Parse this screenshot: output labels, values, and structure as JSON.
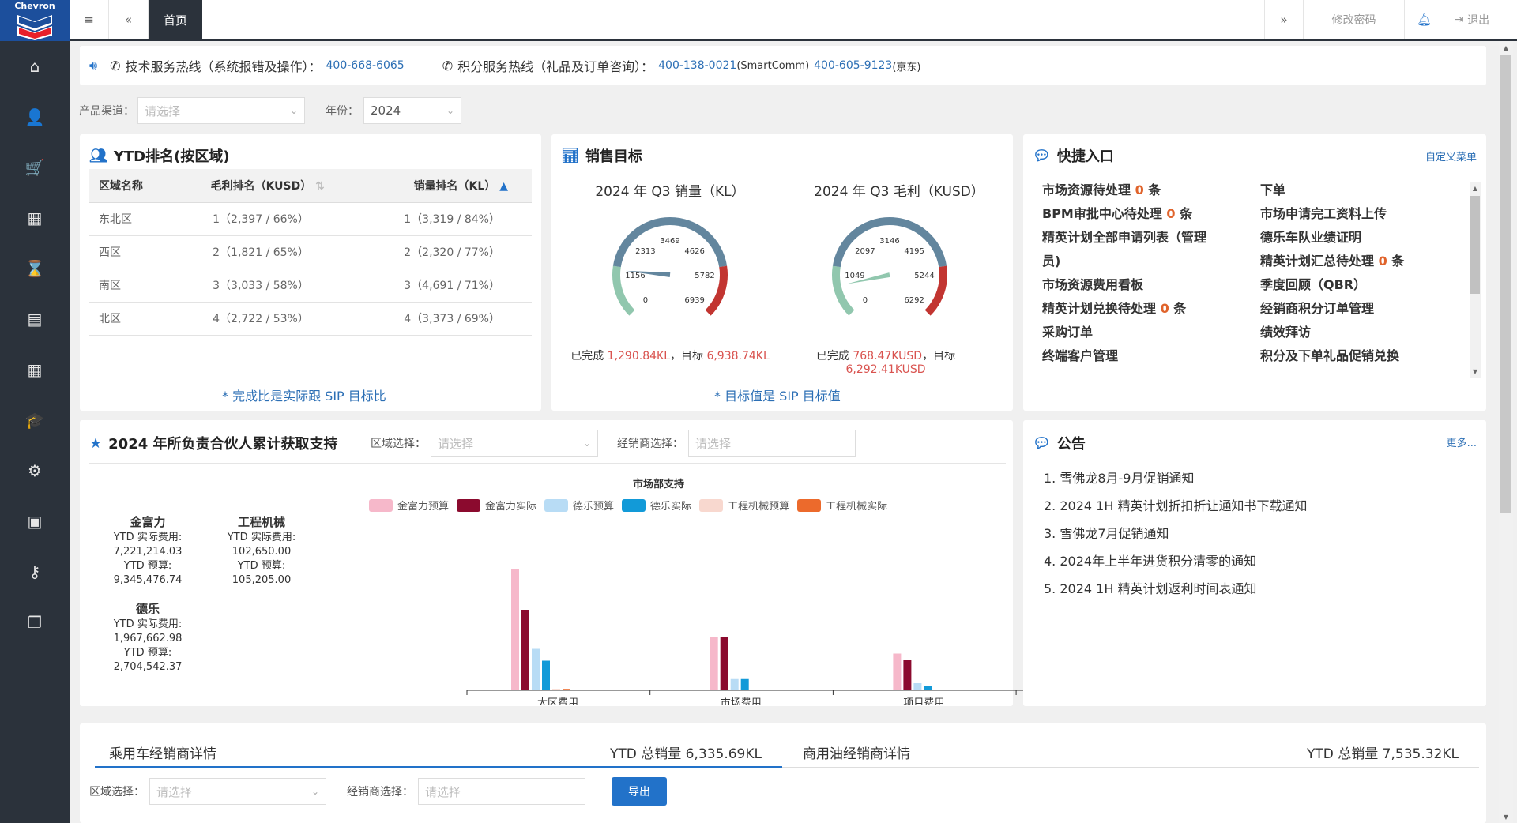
{
  "logo": {
    "text": "Chevron"
  },
  "topbar": {
    "home_tab": "首页",
    "change_password": "修改密码",
    "logout": "退出"
  },
  "hotline": {
    "tech_label": "技术服务热线（系统报错及操作）：",
    "tech_number": "400-668-6065",
    "points_label": "积分服务热线（礼品及订单咨询）：",
    "points_number1": "400-138-0021",
    "points_note1": "(SmartComm)",
    "points_number2": "400-605-9123",
    "points_note2": "(京东)"
  },
  "filters": {
    "channel_label": "产品渠道：",
    "channel_placeholder": "请选择",
    "year_label": "年份：",
    "year_value": "2024"
  },
  "ytd_rank": {
    "title": "YTD排名(按区域)",
    "headers": [
      "区域名称",
      "毛利排名（KUSD）",
      "销量排名（KL）"
    ],
    "rows": [
      [
        "东北区",
        "1（2,397 / 66%）",
        "1（3,319 / 84%）"
      ],
      [
        "西区",
        "2（1,821 / 65%）",
        "2（2,320 / 77%）"
      ],
      [
        "南区",
        "3（3,033 / 58%）",
        "3（4,691 / 71%）"
      ],
      [
        "北区",
        "4（2,722 / 53%）",
        "4（3,373 / 69%）"
      ]
    ],
    "note": "* 完成比是实际跟 SIP 目标比"
  },
  "sales_target": {
    "title": "销售目标",
    "g1_title": "2024 年 Q3 销量（KL）",
    "g1_done_prefix": "已完成 ",
    "g1_done": "1,290.84KL",
    "g1_mid": "，目标 ",
    "g1_target": "6,938.74KL",
    "g2_title": "2024 年 Q3 毛利（KUSD）",
    "g2_done_prefix": "已完成 ",
    "g2_done": "768.47KUSD",
    "g2_mid": "，目标",
    "g2_target": "6,292.41KUSD",
    "note": "* 目标值是 SIP 目标值"
  },
  "gauge1": {
    "value": 1290.84,
    "max": 6938.74,
    "ticks": [
      "0",
      "1156",
      "2313",
      "3469",
      "4626",
      "5782",
      "6939"
    ]
  },
  "gauge2": {
    "value": 768.47,
    "max": 6292.41,
    "ticks": [
      "0",
      "1049",
      "2097",
      "3146",
      "4195",
      "5244",
      "6292"
    ]
  },
  "quick": {
    "title": "快捷入口",
    "custom": "自定义菜单",
    "left": [
      {
        "t": "市场资源待处理 ",
        "n": "0",
        "s": " 条"
      },
      {
        "t": "BPM审批中心待处理 ",
        "n": "0",
        "s": " 条"
      },
      {
        "t": "精英计划全部申请列表（管理",
        "n": "",
        "s": ""
      },
      {
        "t": "员)",
        "n": "",
        "s": ""
      },
      {
        "t": "市场资源费用看板",
        "n": "",
        "s": ""
      },
      {
        "t": "精英计划兑换待处理 ",
        "n": "0",
        "s": " 条"
      },
      {
        "t": "采购订单",
        "n": "",
        "s": ""
      },
      {
        "t": "终端客户管理",
        "n": "",
        "s": ""
      }
    ],
    "right": [
      {
        "t": "下单",
        "n": "",
        "s": ""
      },
      {
        "t": "市场申请完工资料上传",
        "n": "",
        "s": ""
      },
      {
        "t": "德乐车队业绩证明",
        "n": "",
        "s": ""
      },
      {
        "t": "精英计划汇总待处理 ",
        "n": "0",
        "s": " 条"
      },
      {
        "t": "季度回顾（QBR）",
        "n": "",
        "s": ""
      },
      {
        "t": "经销商积分订单管理",
        "n": "",
        "s": ""
      },
      {
        "t": "绩效拜访",
        "n": "",
        "s": ""
      },
      {
        "t": "积分及下单礼品促销兑换",
        "n": "",
        "s": ""
      }
    ]
  },
  "support": {
    "title": "2024 年所负责合伙人累计获取支持",
    "region_label": "区域选择：",
    "region_placeholder": "请选择",
    "dealer_label": "经销商选择：",
    "dealer_placeholder": "请选择",
    "stats": [
      {
        "name": "金富力",
        "l1": "YTD 实际费用:",
        "v1": "7,221,214.03",
        "l2": "YTD 预算:",
        "v2": "9,345,476.74"
      },
      {
        "name": "工程机械",
        "l1": "YTD 实际费用:",
        "v1": "102,650.00",
        "l2": "YTD 预算:",
        "v2": "105,205.00"
      },
      {
        "name": "德乐",
        "l1": "YTD 实际费用:",
        "v1": "1,967,662.98",
        "l2": "YTD 预算:",
        "v2": "2,704,542.37"
      }
    ]
  },
  "chart_data": {
    "type": "bar",
    "title": "市场部支持",
    "categories": [
      "大区费用",
      "市场费用",
      "项目费用"
    ],
    "series": [
      {
        "name": "金富力预算",
        "color": "#f6b8ca",
        "values": [
          1020,
          450,
          310
        ]
      },
      {
        "name": "金富力实际",
        "color": "#8b0a2e",
        "values": [
          680,
          450,
          260
        ]
      },
      {
        "name": "德乐预算",
        "color": "#b8dcf5",
        "values": [
          350,
          95,
          60
        ]
      },
      {
        "name": "德乐实际",
        "color": "#129ad8",
        "values": [
          250,
          95,
          40
        ]
      },
      {
        "name": "工程机械预算",
        "color": "#f8d8cf",
        "values": [
          12,
          0,
          0
        ]
      },
      {
        "name": "工程机械实际",
        "color": "#ec6a2c",
        "values": [
          12,
          0,
          0
        ]
      }
    ],
    "ylim": [
      0,
      1200
    ]
  },
  "notice": {
    "title": "公告",
    "more": "更多...",
    "items": [
      "1. 雪佛龙8月-9月促销通知",
      "2. 2024 1H 精英计划折扣折让通知书下载通知",
      "3. 雪佛龙7月促销通知",
      "4. 2024年上半年进货积分清零的通知",
      "5. 2024 1H 精英计划返利时间表通知"
    ]
  },
  "dealer": {
    "tab1": "乘用车经销商详情",
    "tab1_total": "YTD 总销量 6,335.69KL",
    "tab2": "商用油经销商详情",
    "tab2_total": "YTD 总销量 7,535.32KL",
    "region_label": "区域选择：",
    "region_placeholder": "请选择",
    "dealer_label": "经销商选择：",
    "dealer_placeholder": "请选择",
    "export": "导出"
  }
}
